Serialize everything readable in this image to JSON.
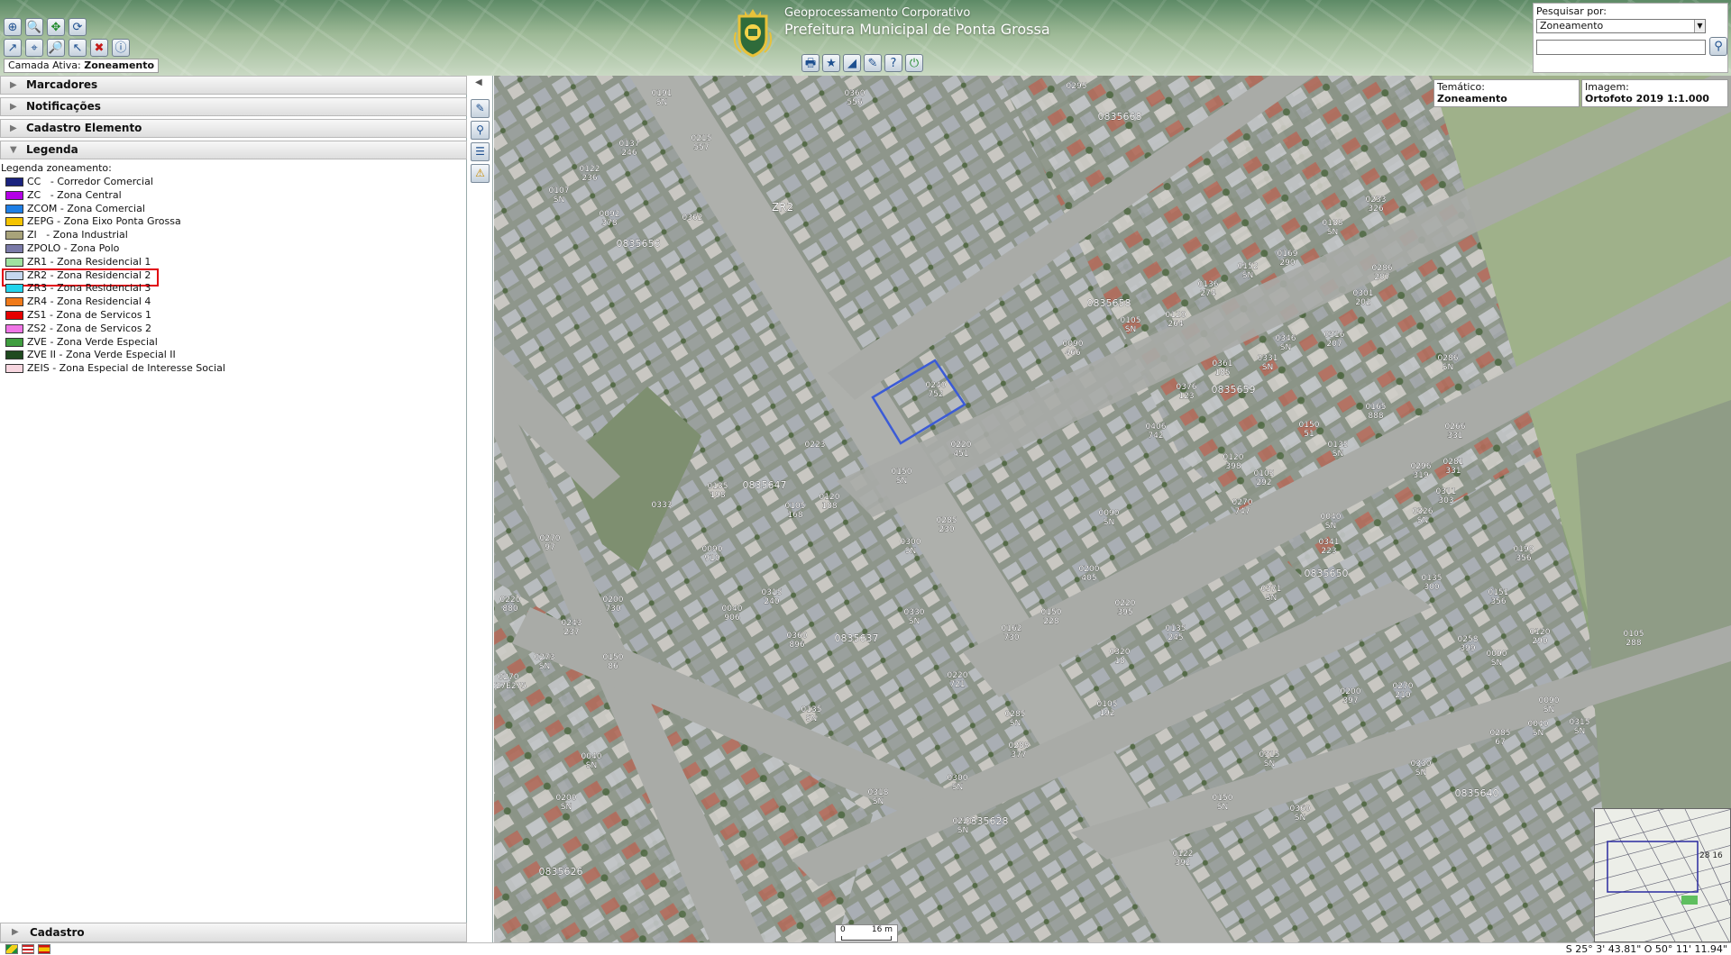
{
  "header": {
    "title_line1": "Geoprocessamento Corporativo",
    "title_line2": "Prefeitura Municipal de Ponta Grossa",
    "active_layer_label": "Camada Ativa:",
    "active_layer_value": "Zoneamento",
    "search": {
      "label": "Pesquisar por:",
      "selected": "Zoneamento",
      "input_value": ""
    }
  },
  "toolbar_top": [
    {
      "name": "zoom-extent-icon",
      "glyph": "⊕"
    },
    {
      "name": "zoom-in-icon",
      "glyph": "🔍"
    },
    {
      "name": "pan-icon",
      "glyph": "✥"
    },
    {
      "name": "refresh-map-icon",
      "glyph": "⟳"
    }
  ],
  "toolbar_bottom": [
    {
      "name": "measure-line-icon",
      "glyph": "↗"
    },
    {
      "name": "measure-area-icon",
      "glyph": "⌖"
    },
    {
      "name": "zoom-out-icon",
      "glyph": "🔎"
    },
    {
      "name": "select-icon",
      "glyph": "↖"
    },
    {
      "name": "clear-icon",
      "glyph": "✖"
    },
    {
      "name": "info-icon",
      "glyph": "ⓘ"
    }
  ],
  "map_tools": [
    {
      "name": "print-icon",
      "glyph": "🖶"
    },
    {
      "name": "favorites-icon",
      "glyph": "★"
    },
    {
      "name": "ruler-icon",
      "glyph": "◢"
    },
    {
      "name": "edit-icon",
      "glyph": "✎"
    },
    {
      "name": "help-icon",
      "glyph": "?"
    },
    {
      "name": "logout-icon",
      "glyph": "⏻"
    }
  ],
  "panels": {
    "marcadores": "Marcadores",
    "notificacoes": "Notificações",
    "cadastro_elemento": "Cadastro Elemento",
    "legenda": "Legenda",
    "cadastro": "Cadastro"
  },
  "legend": {
    "title": "Legenda zoneamento:",
    "items": [
      {
        "label": "CC   - Corredor Comercial",
        "color": "#1a237e"
      },
      {
        "label": "ZC   - Zona Central",
        "color": "#b400e6"
      },
      {
        "label": "ZCOM - Zona Comercial",
        "color": "#1e7fe6"
      },
      {
        "label": "ZEPG - Zona Eixo Ponta Grossa",
        "color": "#f5c400"
      },
      {
        "label": "ZI   - Zona Industrial",
        "color": "#a8a37a"
      },
      {
        "label": "ZPOLO - Zona Polo",
        "color": "#7a7aa8"
      },
      {
        "label": "ZR1 - Zona Residencial 1",
        "color": "#9fe29f"
      },
      {
        "label": "ZR2 - Zona Residencial 2",
        "color": "#c6d8ef",
        "highlighted": true
      },
      {
        "label": "ZR3 - Zona Residencial 3",
        "color": "#22d4ec"
      },
      {
        "label": "ZR4 - Zona Residencial 4",
        "color": "#f07a1a"
      },
      {
        "label": "ZS1 - Zona de Servicos 1",
        "color": "#e60000"
      },
      {
        "label": "ZS2 - Zona de Servicos 2",
        "color": "#f075e6"
      },
      {
        "label": "ZVE - Zona Verde Especial",
        "color": "#3f9e3f"
      },
      {
        "label": "ZVE II - Zona Verde Especial II",
        "color": "#1f4a1f"
      },
      {
        "label": "ZEIS - Zona Especial de Interesse Social",
        "color": "#f7d6df"
      }
    ]
  },
  "side_tools": [
    {
      "name": "layers-edit-icon",
      "glyph": "✎"
    },
    {
      "name": "location-pin-icon",
      "glyph": "⚲"
    },
    {
      "name": "notes-icon",
      "glyph": "☰"
    },
    {
      "name": "warning-icon",
      "glyph": "⚠"
    }
  ],
  "map_info": {
    "tematico_label": "Temático:",
    "tematico_value": "Zoneamento",
    "imagem_label": "Imagem:",
    "imagem_value": "Ortofoto 2019 1:1.000"
  },
  "map_labels": {
    "zone": "ZR2",
    "blocks": [
      "0835668",
      "0835656",
      "0835658",
      "0835659",
      "0835647",
      "0835650",
      "0835637",
      "0835628",
      "0835640",
      "0835626"
    ],
    "lots": [
      "0191 SN",
      "0360 556",
      "0295",
      "0137 246",
      "0215 557",
      "0122 236",
      "0107 SN",
      "0092 378",
      "0362",
      "0233 326",
      "0188 SN",
      "0169 290",
      "0286 207",
      "0152 SN",
      "0136 274",
      "0301 202",
      "0120 264",
      "0105 SN",
      "0316 207",
      "0331 SN",
      "0090 466",
      "0346 SN",
      "0361 185",
      "0286 SN",
      "0240 752",
      "0376 123",
      "0406 742",
      "0165 888",
      "0223",
      "0333",
      "0150 51",
      "0266 331",
      "0220 451",
      "0135 SN",
      "0120 398",
      "0105 292",
      "0281 331",
      "0150 SN",
      "0135 198",
      "0270 747",
      "0090 SN",
      "0296 319",
      "0311 303",
      "0220 880",
      "0120 188",
      "0105 168",
      "0285 230",
      "0040 SN",
      "0326 SN",
      "0341 223",
      "0270 97",
      "0090 910",
      "0300 SN",
      "0200 405",
      "0199 356",
      "0151 356",
      "0315 240",
      "0040 906",
      "0330 SN",
      "0371 SN",
      "0135 300",
      "0200 730",
      "0360 896",
      "0150 228",
      "0220 395",
      "0120 290",
      "0243 237",
      "0162 730",
      "0135 245",
      "0105 288",
      "0258 399",
      "0090 SN",
      "0273 SN",
      "0150 86",
      "0220 721",
      "0320 18",
      "0270 227E275",
      "0135 SN",
      "0105 192",
      "0285 SN",
      "0270 210",
      "0090 SN",
      "0200 397",
      "0288 377",
      "0040 SN",
      "0315 SN",
      "0285 67",
      "0300 SN",
      "0040 SN",
      "0330 SN",
      "0200 SN",
      "0318 SN",
      "0315 SN",
      "0360 SN",
      "0150 SN",
      "0220 SN",
      "0122 392"
    ]
  },
  "scale": {
    "left": "0",
    "right": "16 m"
  },
  "overview_label": "28 16",
  "status": {
    "coords": "S 25° 3' 43.81\" O 50° 11' 11.94\""
  }
}
